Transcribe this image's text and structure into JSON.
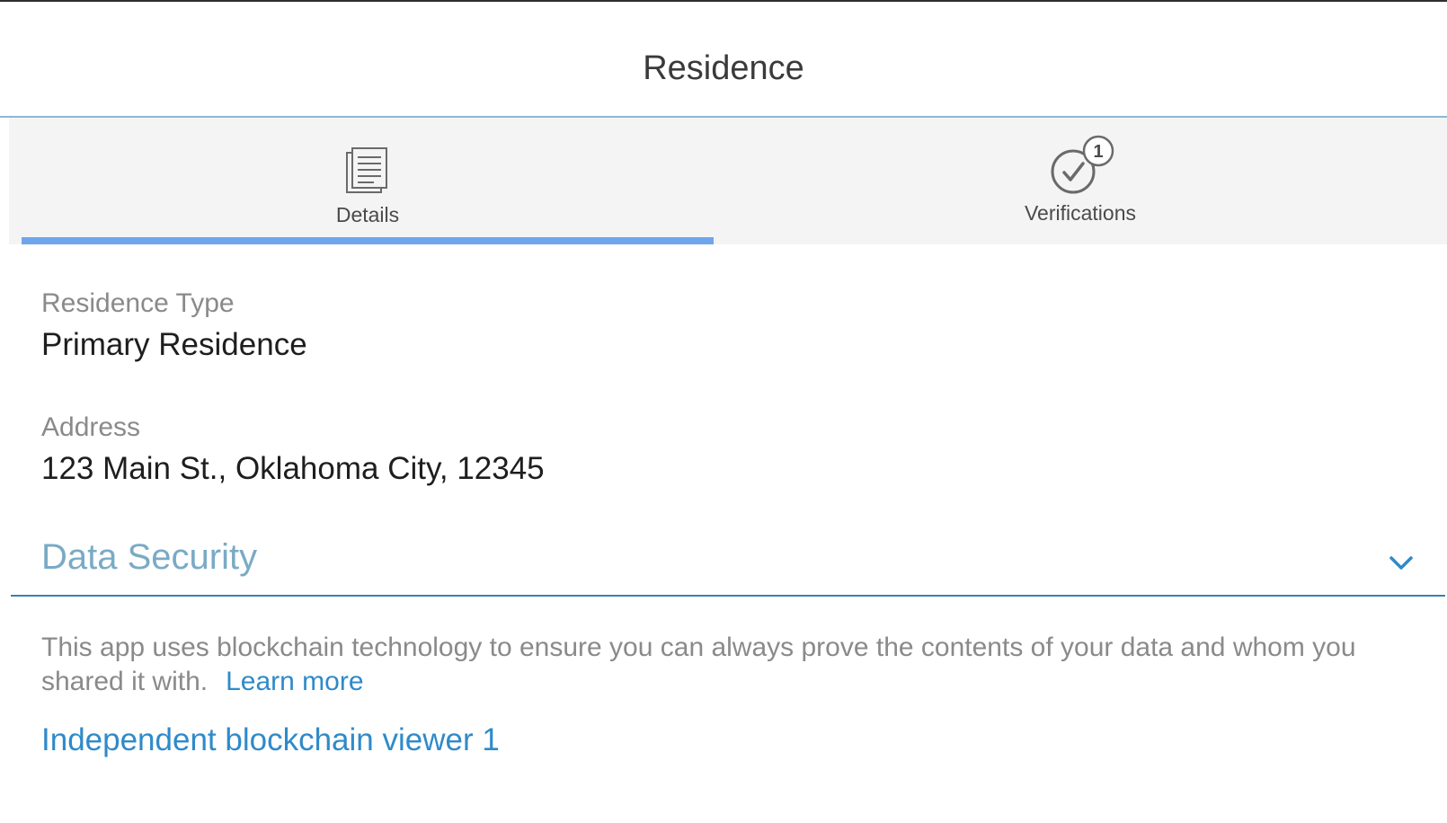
{
  "page": {
    "title": "Residence"
  },
  "tabs": [
    {
      "label": "Details",
      "icon": "document-list-icon",
      "active": true
    },
    {
      "label": "Verifications",
      "icon": "check-circle-icon",
      "badge": "1",
      "active": false
    }
  ],
  "fields": {
    "residence_type": {
      "label": "Residence Type",
      "value": "Primary Residence"
    },
    "address": {
      "label": "Address",
      "value": "123 Main St., Oklahoma City, 12345"
    }
  },
  "data_security": {
    "title": "Data Security",
    "expand_icon": "chevron-down-icon",
    "description": "This app uses blockchain technology to ensure you can always prove the contents of your data and whom you shared it with.",
    "learn_more_label": "Learn more",
    "viewer_link_label": "Independent blockchain viewer 1"
  },
  "colors": {
    "tab_active_underline": "#6fa5ed",
    "link": "#2f8ac9",
    "section_title": "#7aaac5",
    "rule": "#3d7fae"
  }
}
